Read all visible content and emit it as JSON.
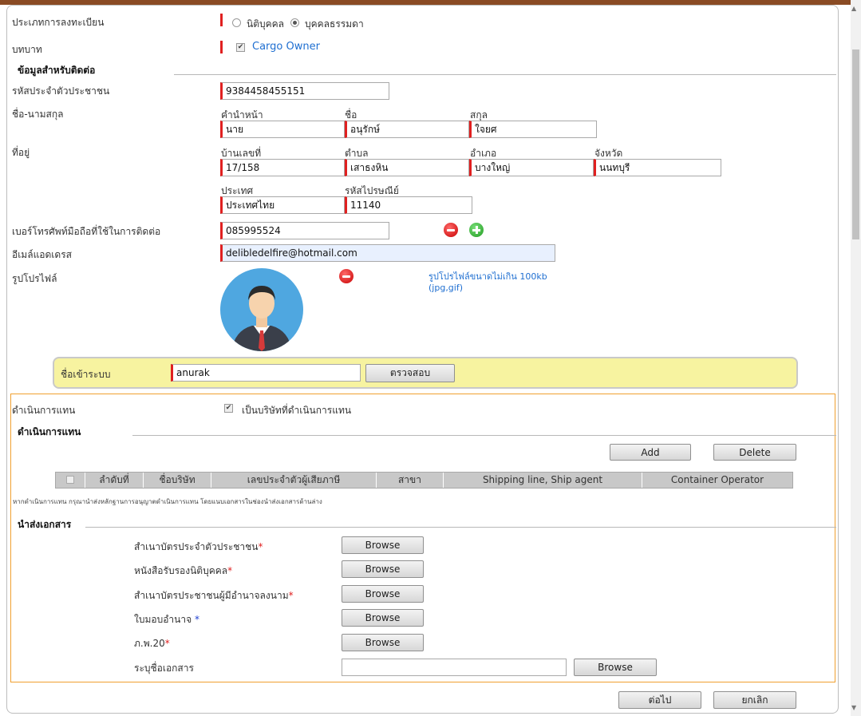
{
  "registration": {
    "type_label": "ประเภทการลงทะเบียน",
    "type_options": [
      "นิติบุคคล",
      "บุคคลธรรมดา"
    ],
    "type_selected": "บุคคลธรรมดา",
    "role_label": "บทบาท",
    "role_option": "Cargo Owner"
  },
  "contact": {
    "section_title": "ข้อมูลสำหรับติดต่อ",
    "id_label": "รหัสประจำตัวประชาชน",
    "id_value": "9384458455151",
    "name_label": "ชื่อ-นามสกุล",
    "title_label": "คำนำหน้า",
    "title_value": "นาย",
    "firstname_label": "ชื่อ",
    "firstname_value": "อนุรักษ์",
    "lastname_label": "สกุล",
    "lastname_value": "ใจยศ",
    "address_label": "ที่อยู่",
    "house_label": "บ้านเลขที่",
    "house_value": "17/158",
    "subdistrict_label": "ตำบล",
    "subdistrict_value": "เสาธงหิน",
    "district_label": "อำเภอ",
    "district_value": "บางใหญ่",
    "province_label": "จังหวัด",
    "province_value": "นนทบุรี",
    "country_label": "ประเทศ",
    "country_value": "ประเทศไทย",
    "postcode_label": "รหัสไปรษณีย์",
    "postcode_value": "11140",
    "phone_label": "เบอร์โทรศัพท์มือถือที่ใช้ในการติดต่อ",
    "phone_value": "085995524",
    "email_label": "อีเมล์แอดเดรส",
    "email_value": "delibledelfire@hotmail.com",
    "profile_label": "รูปโปรไฟล์",
    "profile_hint_1": "รูปโปรไฟล์ขนาดไม่เกิน 100kb",
    "profile_hint_2": "(jpg,gif)"
  },
  "login": {
    "label": "ชื่อเข้าระบบ",
    "value": "anurak",
    "check_button": "ตรวจสอบ"
  },
  "agent": {
    "label": "ดำเนินการแทน",
    "checkbox_label": "เป็นบริษัทที่ดำเนินการแทน",
    "section_title": "ดำเนินการแทน",
    "add_button": "Add",
    "delete_button": "Delete",
    "columns": [
      "ลำดับที่",
      "ชื่อบริษัท",
      "เลขประจำตัวผู้เสียภาษี",
      "สาขา",
      "Shipping line, Ship agent",
      "Container Operator"
    ],
    "note": "หากดำเนินการแทน กรุณานำส่งหลักฐานการอนุญาตดำเนินการแทน โดยแนบเอกสารในช่องนำส่งเอกสารด้านล่าง"
  },
  "documents": {
    "section_title": "นำส่งเอกสาร",
    "items": [
      {
        "label": "สำเนาบัตรประจำตัวประชาชน",
        "star": "*"
      },
      {
        "label": "หนังสือรับรองนิติบุคคล",
        "star": "*"
      },
      {
        "label": "สำเนาบัตรประชาชนผู้มีอำนาจลงนาม",
        "star": "*"
      },
      {
        "label": "ใบมอบอำนาจ ",
        "star": "*"
      },
      {
        "label": "ภ.พ.20",
        "star": "*"
      }
    ],
    "browse_label": "Browse",
    "custom_label": "ระบุชื่อเอกสาร",
    "custom_value": ""
  },
  "footer": {
    "next_button": "ต่อไป",
    "cancel_button": "ยกเลิก"
  },
  "colors": {
    "required": "#e02020",
    "link": "#1f6fd1",
    "login_bg": "#f7f3a0",
    "agent_border": "#f0a030"
  }
}
